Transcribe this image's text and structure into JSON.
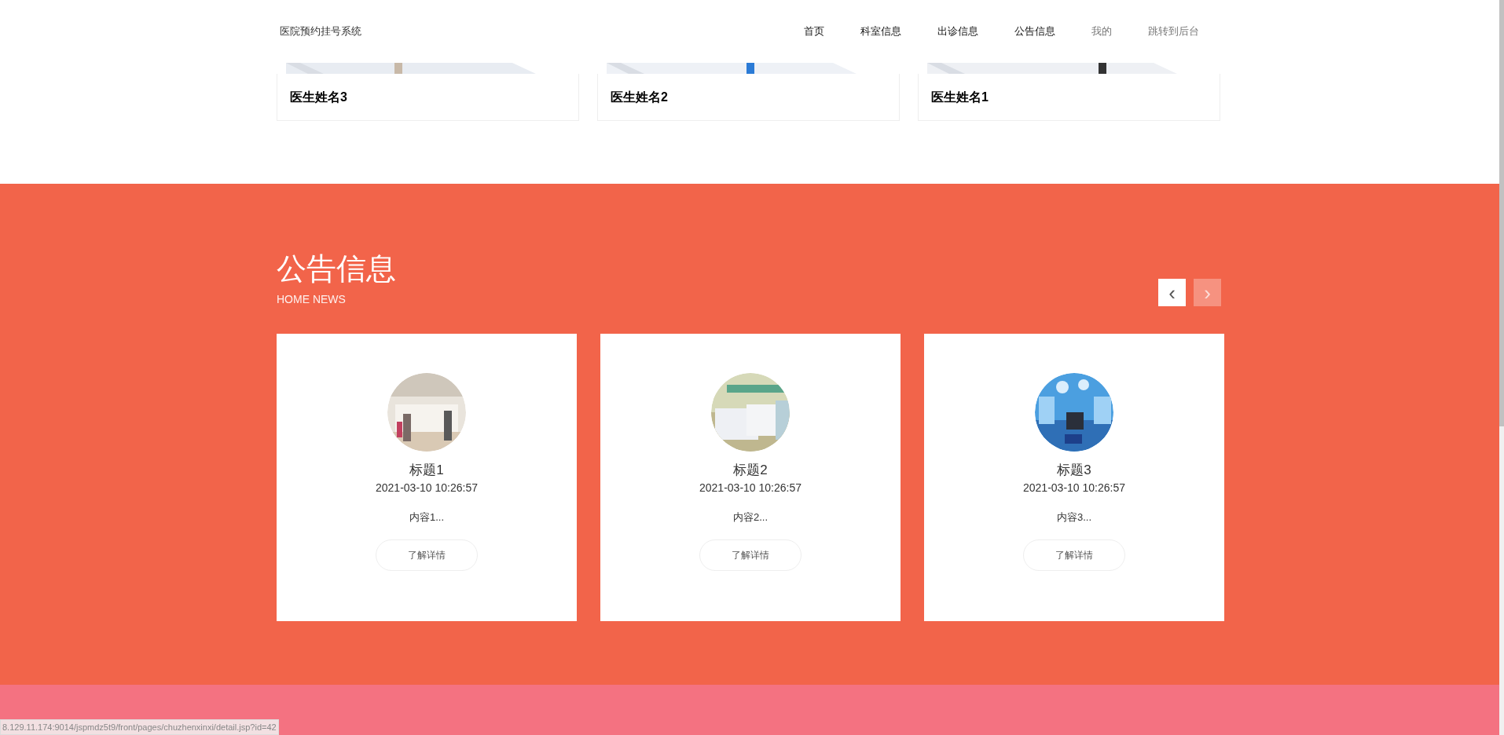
{
  "header": {
    "site_title": "医院预约挂号系统",
    "nav": [
      {
        "label": "首页",
        "dimmed": false
      },
      {
        "label": "科室信息",
        "dimmed": false
      },
      {
        "label": "出诊信息",
        "dimmed": false
      },
      {
        "label": "公告信息",
        "dimmed": false
      },
      {
        "label": "我的",
        "dimmed": true
      },
      {
        "label": "跳转到后台",
        "dimmed": true
      }
    ]
  },
  "doctors": [
    {
      "name": "医生姓名3"
    },
    {
      "name": "医生姓名2"
    },
    {
      "name": "医生姓名1"
    }
  ],
  "news": {
    "title": "公告信息",
    "subtitle": "HOME NEWS",
    "prev_arrow": "‹",
    "next_arrow": "›",
    "items": [
      {
        "title": "标题1",
        "time": "2021-03-10 10:26:57",
        "summary": "内容1...",
        "button": "了解详情"
      },
      {
        "title": "标题2",
        "time": "2021-03-10 10:26:57",
        "summary": "内容2...",
        "button": "了解详情"
      },
      {
        "title": "标题3",
        "time": "2021-03-10 10:26:57",
        "summary": "内容3...",
        "button": "了解详情"
      }
    ]
  },
  "status_bar": "8.129.11.174:9014/jspmdz5t9/front/pages/chuzhenxinxi/detail.jsp?id=42"
}
